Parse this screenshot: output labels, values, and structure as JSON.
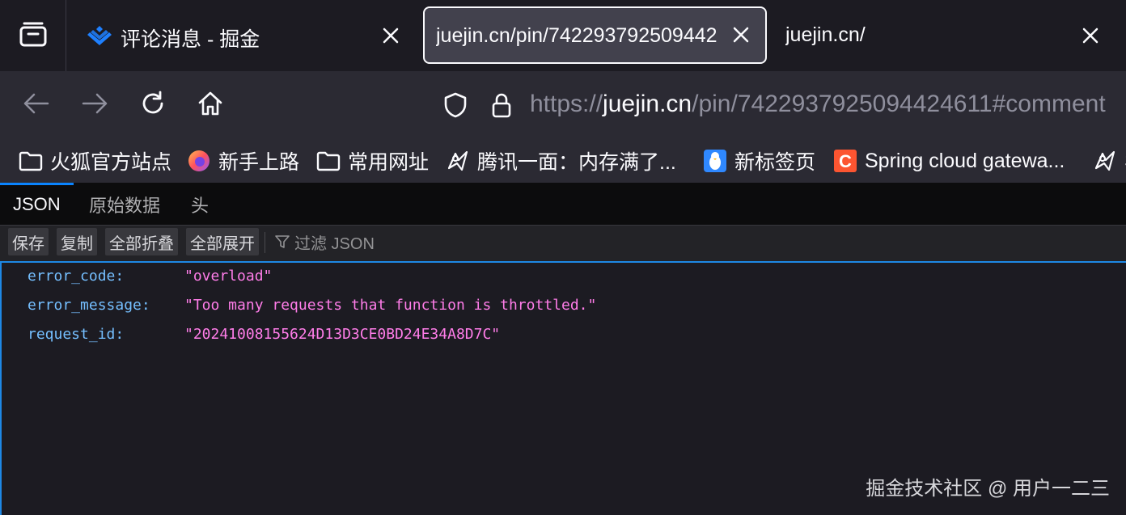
{
  "tabs": [
    {
      "title": "评论消息 - 掘金",
      "favicon": "juejin-logo-icon",
      "active": false
    },
    {
      "title_main": "juejin.cn/pin/742293792509442",
      "title_fade": "",
      "active": true
    },
    {
      "title": "juejin.cn/",
      "active": false
    }
  ],
  "nav": {
    "url_prefix": "https://",
    "url_host": "juejin.cn",
    "url_rest": "/pin/7422937925094424611#comment"
  },
  "bookmarks": [
    {
      "label": "火狐官方站点",
      "icon": "folder-icon"
    },
    {
      "label": "新手上路",
      "icon": "firefox-icon"
    },
    {
      "label": "常用网址",
      "icon": "folder-icon"
    },
    {
      "label": "腾讯一面：内存满了...",
      "icon": "bookmark-bird-icon"
    },
    {
      "label": "新标签页",
      "icon": "penguin-icon"
    },
    {
      "label": "Spring cloud gatewa...",
      "icon": "csdn-icon"
    },
    {
      "label": "S",
      "icon": "bookmark-bird-icon"
    }
  ],
  "viewer": {
    "tabs": [
      "JSON",
      "原始数据",
      "头"
    ],
    "toolbar": {
      "save": "保存",
      "copy": "复制",
      "collapse_all": "全部折叠",
      "expand_all": "全部展开",
      "filter_placeholder": "过滤 JSON"
    },
    "rows": [
      {
        "key": "error_code:",
        "value": "\"overload\""
      },
      {
        "key": "error_message:",
        "value": "\"Too many requests that function is throttled.\""
      },
      {
        "key": "request_id:",
        "value": "\"20241008155624D13D3CE0BD24E34A8D7C\""
      }
    ]
  },
  "watermark": "掘金技术社区 @ 用户一二三",
  "colors": {
    "json_key": "#75bfff",
    "json_string": "#ff7de9",
    "accent": "#1e88e5"
  }
}
